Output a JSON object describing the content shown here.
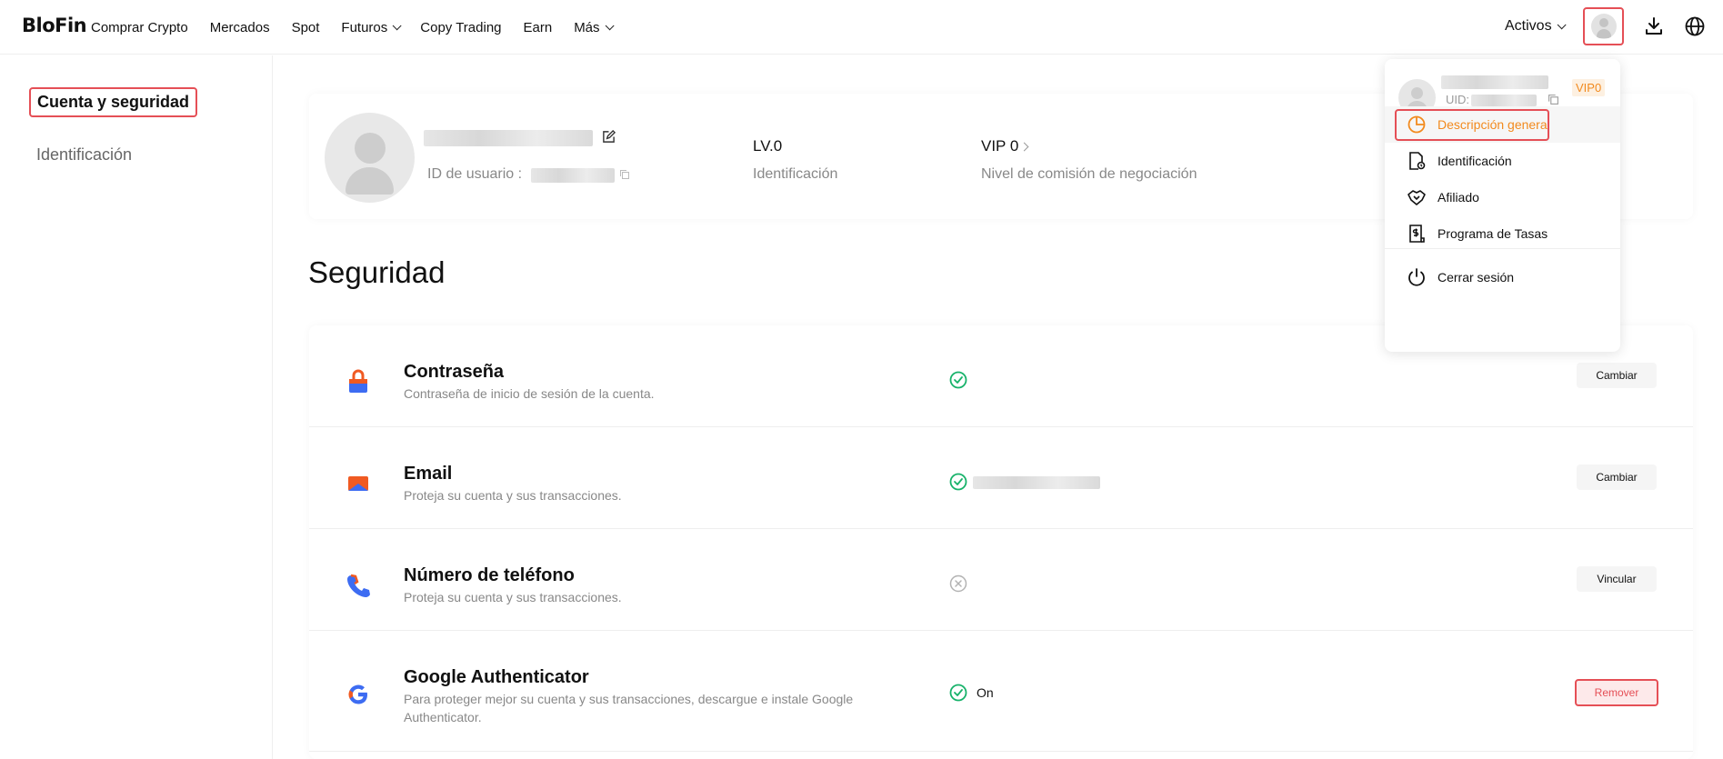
{
  "nav": {
    "logo": "BloFin",
    "links": [
      "Comprar Crypto",
      "Mercados",
      "Spot",
      "Futuros",
      "Copy Trading",
      "Earn",
      "Más"
    ],
    "activos": "Activos"
  },
  "sidebar": {
    "items": [
      "Cuenta y seguridad",
      "Identificación"
    ]
  },
  "profile": {
    "uid_label": "ID de usuario :",
    "level": "LV.0",
    "level_label": "Identificación",
    "vip": "VIP 0",
    "vip_label": "Nivel de comisión de negociación"
  },
  "security": {
    "title": "Seguridad",
    "rows": [
      {
        "title": "Contraseña",
        "desc": "Contraseña de inicio de sesión de la cuenta.",
        "status": "verified",
        "status_text": "",
        "button": "Cambiar"
      },
      {
        "title": "Email",
        "desc": "Proteja su cuenta y sus transacciones.",
        "status": "verified",
        "status_text": "",
        "button": "Cambiar"
      },
      {
        "title": "Número de teléfono",
        "desc": "Proteja su cuenta y sus transacciones.",
        "status": "unverified",
        "status_text": "",
        "button": "Vincular"
      },
      {
        "title": "Google Authenticator",
        "desc": "Para proteger mejor su cuenta y sus transacciones, descargue e instale Google Authenticator.",
        "status": "verified",
        "status_text": "On",
        "button": "Remover"
      }
    ]
  },
  "dropdown": {
    "uid_label": "UID:",
    "vip_badge": "VIP0",
    "items": [
      "Descripción general",
      "Identificación",
      "Afiliado",
      "Programa de Tasas",
      "Cerrar sesión"
    ]
  },
  "colors": {
    "accent": "#f28a1e",
    "success": "#17b26a",
    "highlight": "#e54f56"
  }
}
